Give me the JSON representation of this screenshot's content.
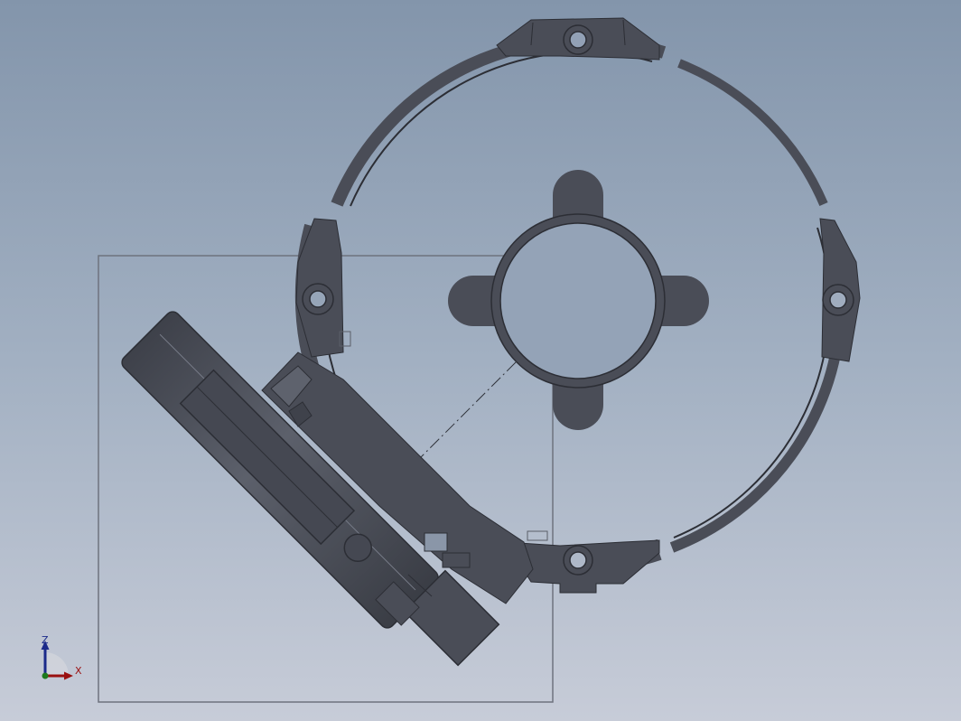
{
  "triad": {
    "z_label": "Z",
    "x_label": "X"
  },
  "colors": {
    "background_top": "#8395ab",
    "background_bottom": "#c7ccd8",
    "part": "#4a4d57",
    "part_edge": "#2c2e35",
    "part_highlight": "#5e626d",
    "sketch_line": "#6e737e",
    "axis_z": "#1b2a8a",
    "axis_x": "#9a1010"
  }
}
